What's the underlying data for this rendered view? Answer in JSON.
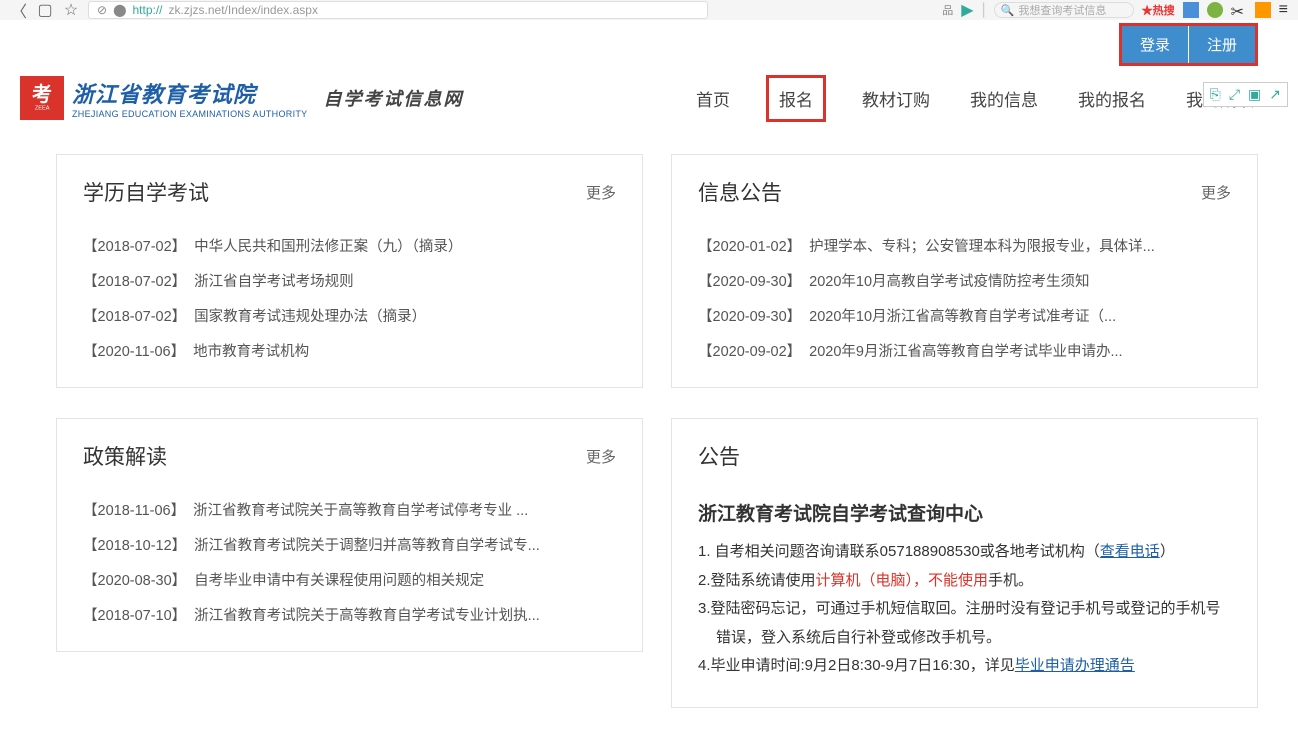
{
  "browser": {
    "url_prefix": "http://",
    "url": "zk.zjzs.net/Index/index.aspx",
    "search_placeholder": "我想查询考试信息",
    "hot_label": "★热搜"
  },
  "auth": {
    "login": "登录",
    "register": "注册"
  },
  "logo": {
    "sq_sub": "ZEEA",
    "cn": "浙江省教育考试院",
    "en": "ZHEJIANG EDUCATION EXAMINATIONS AUTHORITY",
    "sub": "自学考试信息网"
  },
  "nav": {
    "home": "首页",
    "signup": "报名",
    "textbook": "教材订购",
    "myinfo": "我的信息",
    "myreg": "我的报名",
    "myscore": "我的成绩"
  },
  "panel1": {
    "title": "学历自学考试",
    "more": "更多",
    "items": [
      {
        "date": "【2018-07-02】",
        "text": "中华人民共和国刑法修正案（九）（摘录）"
      },
      {
        "date": "【2018-07-02】",
        "text": "浙江省自学考试考场规则"
      },
      {
        "date": "【2018-07-02】",
        "text": "国家教育考试违规处理办法（摘录）"
      },
      {
        "date": "【2020-11-06】",
        "text": "地市教育考试机构"
      }
    ]
  },
  "panel2": {
    "title": "信息公告",
    "more": "更多",
    "items": [
      {
        "date": "【2020-01-02】",
        "text": "护理学本、专科；公安管理本科为限报专业，具体详..."
      },
      {
        "date": "【2020-09-30】",
        "text": "2020年10月高教自学考试疫情防控考生须知"
      },
      {
        "date": "【2020-09-30】",
        "text": "2020年10月浙江省高等教育自学考试准考证（..."
      },
      {
        "date": "【2020-09-02】",
        "text": "2020年9月浙江省高等教育自学考试毕业申请办..."
      }
    ]
  },
  "panel3": {
    "title": "政策解读",
    "more": "更多",
    "items": [
      {
        "date": "【2018-11-06】",
        "text": "浙江省教育考试院关于高等教育自学考试停考专业 ..."
      },
      {
        "date": "【2018-10-12】",
        "text": "浙江省教育考试院关于调整归并高等教育自学考试专..."
      },
      {
        "date": "【2020-08-30】",
        "text": "自考毕业申请中有关课程使用问题的相关规定"
      },
      {
        "date": "【2018-07-10】",
        "text": "浙江省教育考试院关于高等教育自学考试专业计划执..."
      }
    ]
  },
  "panel4": {
    "title": "公告",
    "notice_title": "浙江教育考试院自学考试查询中心",
    "line1_a": "1. 自考相关问题咨询请联系057188908530或各地考试机构（",
    "line1_link": "查看电话",
    "line1_b": "）",
    "line2_a": "2.登陆系统请使用",
    "line2_warn": "计算机（电脑），不能使用",
    "line2_b": "手机。",
    "line3": "3.登陆密码忘记，可通过手机短信取回。注册时没有登记手机号或登记的手机号错误，登入系统后自行补登或修改手机号。",
    "line4_a": "4.毕业申请时间:9月2日8:30-9月7日16:30，详见",
    "line4_link": "毕业申请办理通告"
  }
}
